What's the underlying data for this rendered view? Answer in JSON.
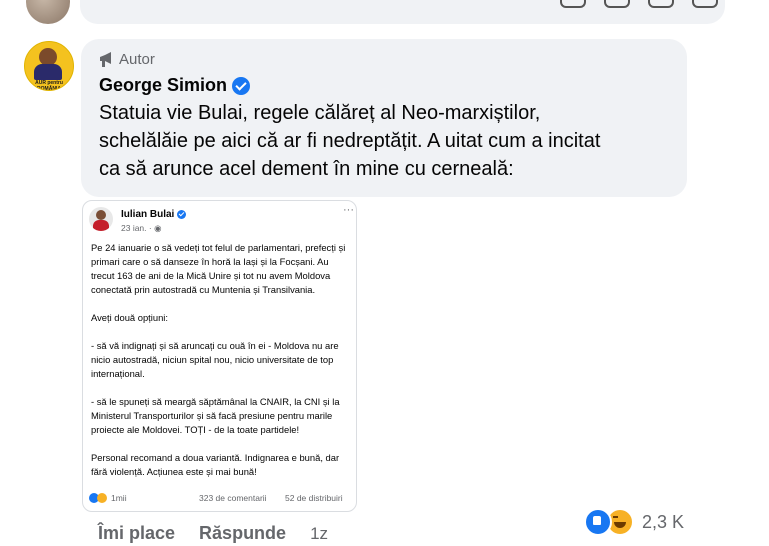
{
  "comment": {
    "badge_label": "Autor",
    "author_name": "George Simion",
    "avatar_text": "AUR pentru ROMÂNIA",
    "lines": [
      "Statuia vie Bulai, regele călăreț al Neo-marxiștilor,",
      "schelălăie pe aici că ar fi nedreptățit. A uitat cum a incitat",
      "ca să arunce acel dement în mine cu cerneală:"
    ]
  },
  "shared_post": {
    "author": "Iulian Bulai",
    "date": "23 ian. ·",
    "more": "···",
    "paragraphs": [
      "Pe 24 ianuarie o să vedeți tot felul de parlamentari, prefecți și primari care o să danseze în horă la Iași și la Focșani. Au trecut 163 de ani de la Mică Unire și tot nu avem Moldova conectată prin autostradă cu Muntenia și Transilvania.",
      "Aveți două opțiuni:",
      "- să vă indignați și să aruncați cu ouă în ei - Moldova nu are nicio autostradă, niciun spital nou, nicio universitate de top internațional.",
      "- să le spuneți să meargă săptămânal la CNAIR, la CNI și la Ministerul Transporturilor și să facă presiune pentru marile proiecte ale Moldovei. TOȚI - de la toate partidele!",
      "Personal recomand a doua variantă. Indignarea e bună, dar fără violență. Acțiunea este și mai bună!"
    ],
    "reactions_count": "1mii",
    "comments_count": "323 de comentarii",
    "shares_count": "52 de distribuiri"
  },
  "actions": {
    "like_label": "Îmi place",
    "reply_label": "Răspunde",
    "time": "1z"
  },
  "reactions": {
    "count": "2,3 K",
    "icons": [
      "like-icon",
      "haha-icon"
    ]
  }
}
